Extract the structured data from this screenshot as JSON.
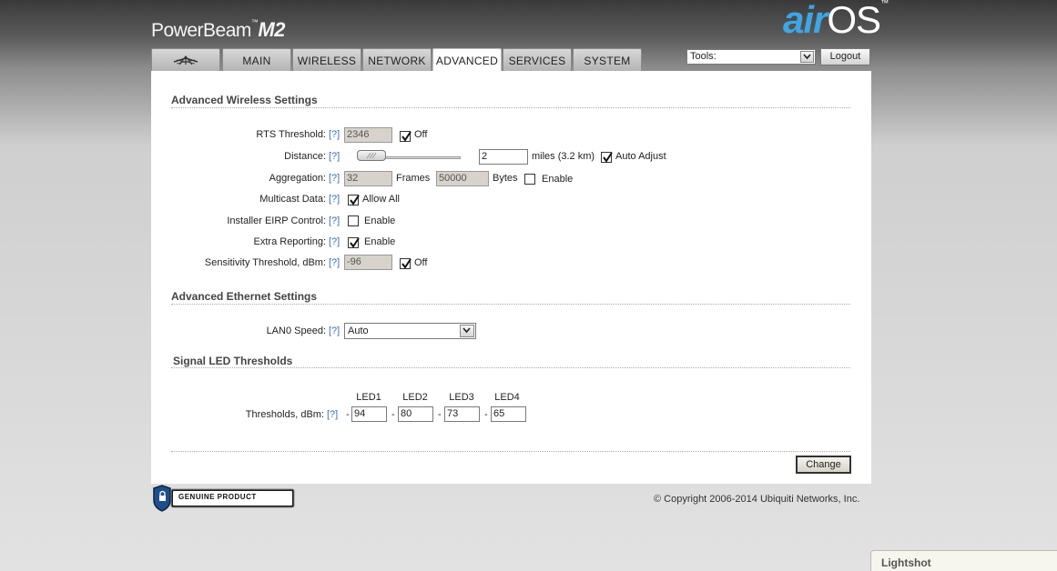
{
  "header": {
    "product_name": "PowerBeam",
    "product_model": "M2",
    "brand_air": "air",
    "brand_os": "OS",
    "tm": "™"
  },
  "tabs": [
    "MAIN",
    "WIRELESS",
    "NETWORK",
    "ADVANCED",
    "SERVICES",
    "SYSTEM"
  ],
  "active_tab": "ADVANCED",
  "tools": {
    "selected": "Tools:"
  },
  "logout_label": "Logout",
  "help_link": "[?]",
  "wireless": {
    "title": "Advanced Wireless Settings",
    "rts": {
      "label": "RTS Threshold:",
      "value": "2346",
      "off_label": "Off",
      "off_checked": true
    },
    "distance": {
      "label": "Distance:",
      "value": "2",
      "unit": "miles (3.2 km)",
      "auto_label": "Auto Adjust",
      "auto_checked": true
    },
    "aggregation": {
      "label": "Aggregation:",
      "frames_value": "32",
      "frames_label": "Frames",
      "bytes_value": "50000",
      "bytes_label": "Bytes",
      "enable_label": "Enable",
      "enable_checked": false
    },
    "multicast": {
      "label": "Multicast Data:",
      "allow_label": "Allow All",
      "checked": true
    },
    "eirp": {
      "label": "Installer EIRP Control:",
      "enable_label": "Enable",
      "checked": false
    },
    "extra": {
      "label": "Extra Reporting:",
      "enable_label": "Enable",
      "checked": true
    },
    "sensitivity": {
      "label": "Sensitivity Threshold, dBm:",
      "value": "-96",
      "off_label": "Off",
      "off_checked": true
    }
  },
  "ethernet": {
    "title": "Advanced Ethernet Settings",
    "lan0": {
      "label": "LAN0 Speed:",
      "value": "Auto"
    }
  },
  "led": {
    "title": "Signal LED Thresholds",
    "headers": [
      "LED1",
      "LED2",
      "LED3",
      "LED4"
    ],
    "label": "Thresholds, dBm:",
    "dash": "-",
    "values": [
      "94",
      "80",
      "73",
      "65"
    ]
  },
  "change_label": "Change",
  "footer": {
    "genuine_product": "GENUINE PRODUCT",
    "copyright": "© Copyright 2006-2014 Ubiquiti Networks, Inc."
  },
  "lightshot": "Lightshot",
  "colors": {
    "brand_blue": "#3ea6e4",
    "help_blue": "#3a6fb5",
    "panel_bg": "#ffffff"
  }
}
